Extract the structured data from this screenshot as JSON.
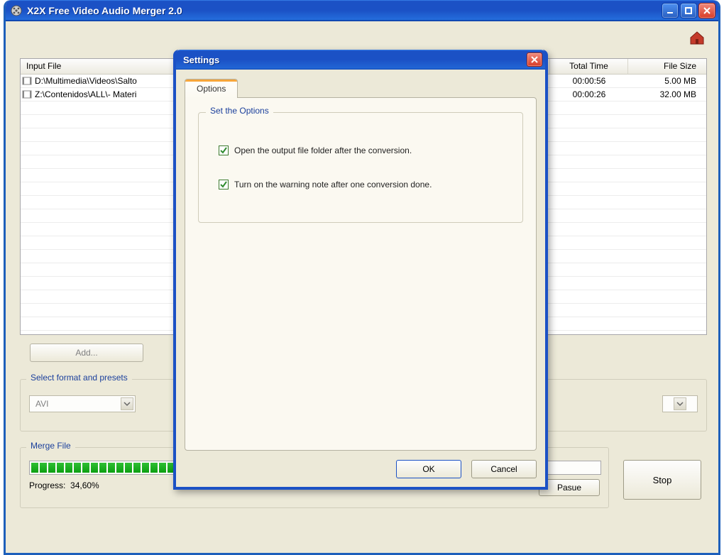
{
  "window": {
    "title": "X2X Free Video Audio Merger 2.0"
  },
  "files": {
    "columns": {
      "input": "Input File",
      "time": "Total Time",
      "size": "File Size"
    },
    "rows": [
      {
        "path": "D:\\Multimedia\\Videos\\Salto",
        "time": "00:00:56",
        "size": "5.00 MB"
      },
      {
        "path": "Z:\\Contenidos\\ALL\\- Materi",
        "time": "00:00:26",
        "size": "32.00 MB"
      }
    ]
  },
  "buttons": {
    "add": "Add...",
    "stop": "Stop",
    "pause": "Pasue"
  },
  "format": {
    "legend": "Select format and presets",
    "selected": "AVI"
  },
  "merge": {
    "legend": "Merge File",
    "progress_label": "Progress:",
    "progress_value": "34,60%",
    "segments": 22
  },
  "dialog": {
    "title": "Settings",
    "tab": "Options",
    "fieldset_legend": "Set the Options",
    "opt1": "Open the output file folder after the conversion.",
    "opt2": "Turn on the warning note after one conversion done.",
    "ok": "OK",
    "cancel": "Cancel"
  }
}
